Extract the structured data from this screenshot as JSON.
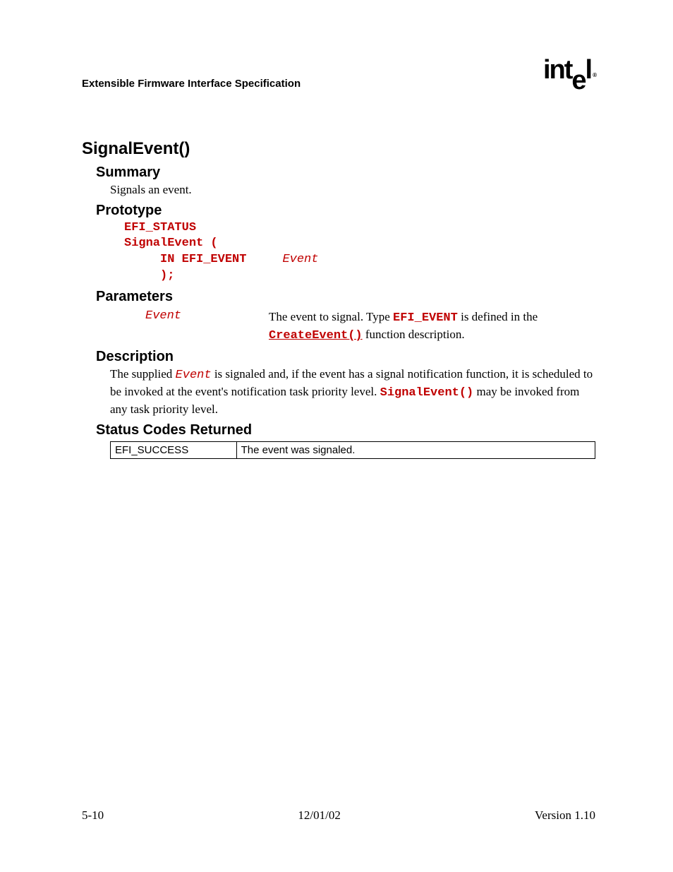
{
  "header": {
    "doc_title": "Extensible Firmware Interface Specification",
    "logo": "intel",
    "logo_reg": "®"
  },
  "title": "SignalEvent()",
  "summary": {
    "heading": "Summary",
    "text": "Signals an event."
  },
  "prototype": {
    "heading": "Prototype",
    "l1": "EFI_STATUS",
    "l2": "SignalEvent (",
    "l3a": "     IN EFI_EVENT     ",
    "l3b": "Event",
    "l4": "     );"
  },
  "parameters": {
    "heading": "Parameters",
    "rows": [
      {
        "name": "Event",
        "d1": "The event to signal.  Type ",
        "d_code1": "EFI_EVENT",
        "d2": " is defined in the ",
        "d_code2": "CreateEvent()",
        "d3": " function description."
      }
    ]
  },
  "description": {
    "heading": "Description",
    "t1": "The supplied ",
    "t_code1": "Event",
    "t2": " is signaled and, if the event has a signal notification function, it is scheduled to be invoked at the event's notification task priority level.  ",
    "t_code2": "SignalEvent()",
    "t3": " may be invoked from any task priority level."
  },
  "status": {
    "heading": "Status Codes Returned",
    "rows": [
      {
        "code": "EFI_SUCCESS",
        "meaning": "The event was signaled."
      }
    ]
  },
  "footer": {
    "left": "5-10",
    "center": "12/01/02",
    "right": "Version 1.10"
  }
}
